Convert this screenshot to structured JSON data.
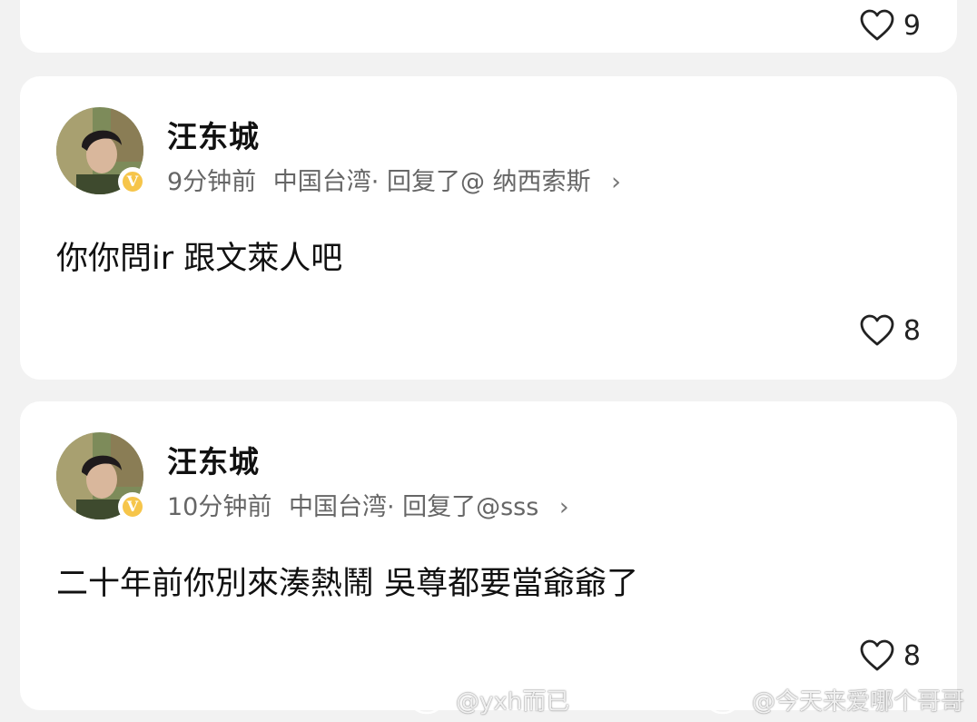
{
  "top_comment": {
    "like_count": "9"
  },
  "comments": [
    {
      "username": "汪东城",
      "time": "9分钟前",
      "location": "中国台湾",
      "reply_to": "· 回复了@ 纳西索斯",
      "text": "你你問ir 跟文萊人吧",
      "like_count": "8",
      "badge": "V"
    },
    {
      "username": "汪东城",
      "time": "10分钟前",
      "location": "中国台湾",
      "reply_to": "· 回复了@sss",
      "text": "二十年前你別來湊熱鬧 吳尊都要當爺爺了",
      "like_count": "8",
      "badge": "V"
    }
  ],
  "watermarks": [
    {
      "text": "@yxh而已",
      "icon": "weibo-logo-icon"
    },
    {
      "text": "@今天来爱哪个哥哥",
      "icon": "weibo-logo-icon"
    }
  ],
  "colors": {
    "background": "#f2f2f2",
    "card": "#ffffff",
    "meta_text": "#666666",
    "badge": "#f6c54a"
  }
}
